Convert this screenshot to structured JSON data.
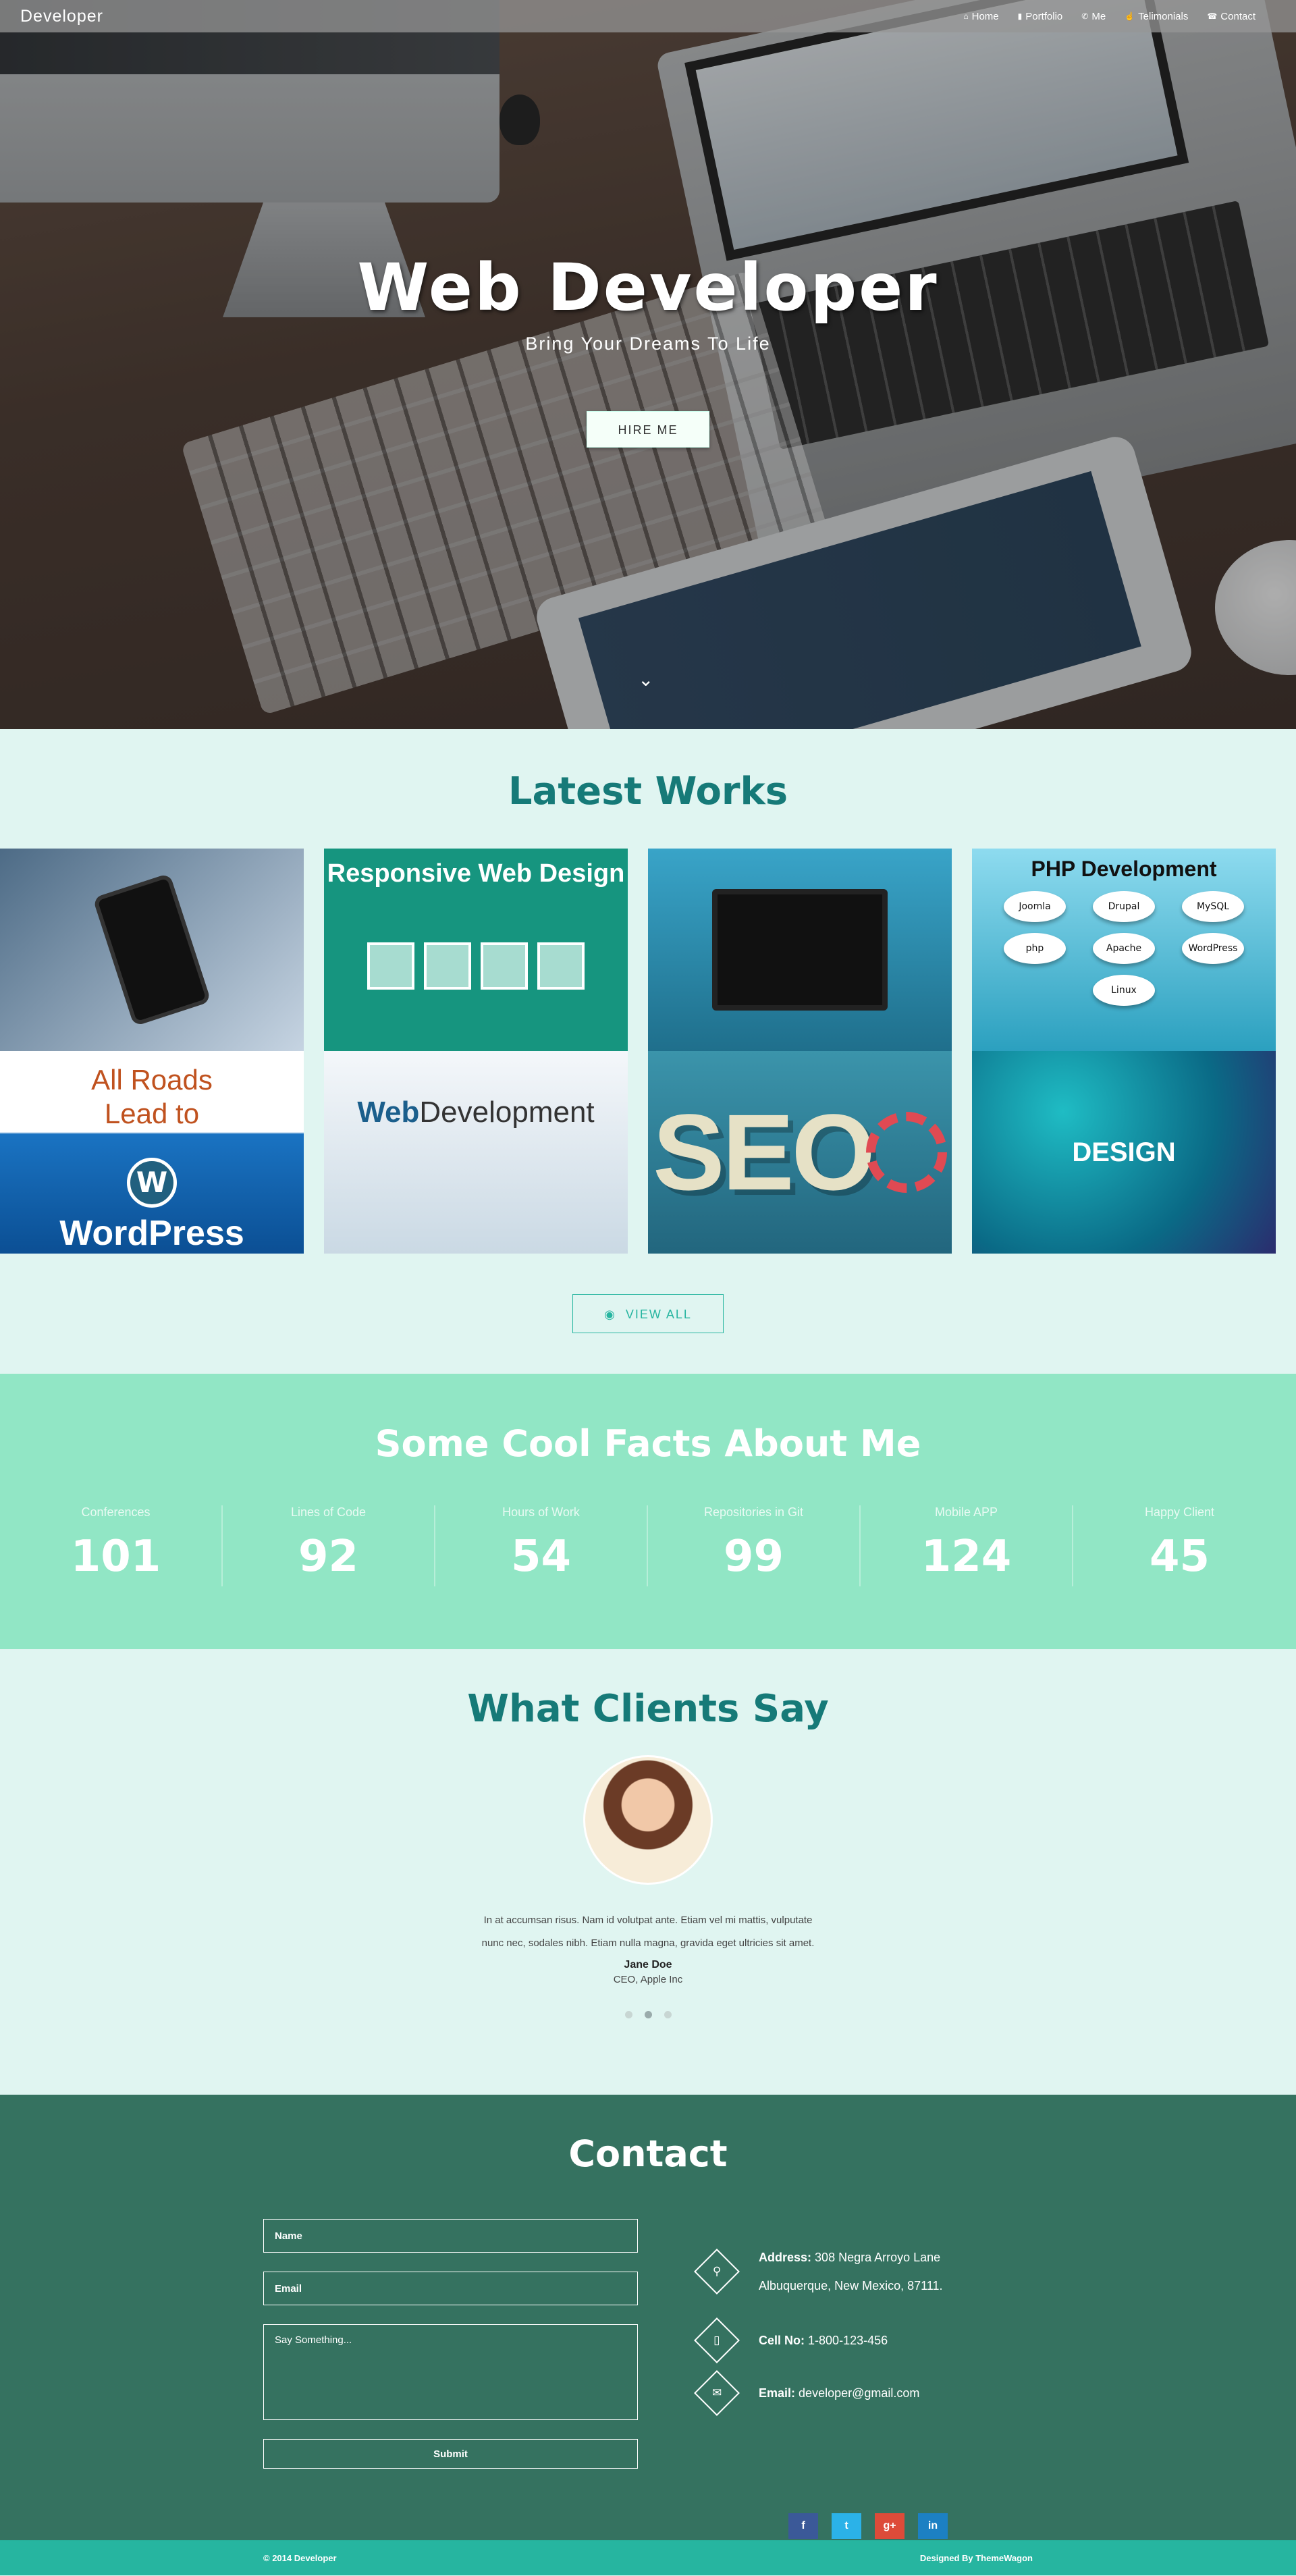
{
  "nav": {
    "brand": "Developer",
    "links": [
      {
        "icon": "home-icon",
        "glyph": "⌂",
        "label": "Home"
      },
      {
        "icon": "bookmark-icon",
        "glyph": "▮",
        "label": "Portfolio"
      },
      {
        "icon": "megaphone-icon",
        "glyph": "✆",
        "label": "Me"
      },
      {
        "icon": "thumbs-up-icon",
        "glyph": "☝",
        "label": "Telimonials"
      },
      {
        "icon": "phone-icon",
        "glyph": "☎",
        "label": "Contact"
      }
    ]
  },
  "hero": {
    "title": "Web Developer",
    "subtitle": "Bring Your Dreams To Life",
    "cta": "HIRE ME",
    "scroll_icon": "chevron-down-icon",
    "scroll_glyph": "⌄"
  },
  "works": {
    "title": "Latest Works",
    "tiles": {
      "responsive": "Responsive Web Design",
      "php": "PHP Development",
      "php_logos": [
        "Joomla",
        "Drupal",
        "MySQL",
        "php",
        "Apache",
        "WordPress",
        "Linux"
      ],
      "wp_line1": "All Roads",
      "wp_line2": "Lead to",
      "wp_line3": "WordPress",
      "wp_logo": "W",
      "webdev_a": "Web",
      "webdev_b": "Development",
      "seo": "SEO",
      "design": "DESIGN"
    },
    "view_all": "VIEW ALL",
    "view_all_icon": "eye-icon",
    "view_all_glyph": "◉"
  },
  "facts": {
    "title": "Some Cool Facts About Me",
    "items": [
      {
        "label": "Conferences",
        "value": "101"
      },
      {
        "label": "Lines of Code",
        "value": "92"
      },
      {
        "label": "Hours of Work",
        "value": "54"
      },
      {
        "label": "Repositories in Git",
        "value": "99"
      },
      {
        "label": "Mobile APP",
        "value": "124"
      },
      {
        "label": "Happy Client",
        "value": "45"
      }
    ]
  },
  "clients": {
    "title": "What Clients Say",
    "quote": "In at accumsan risus. Nam id volutpat ante. Etiam vel mi mattis, vulputate nunc nec, sodales nibh. Etiam nulla magna, gravida eget ultricies sit amet.",
    "name": "Jane Doe",
    "role": "CEO, Apple Inc",
    "slides": 3,
    "active_slide": 2
  },
  "contact": {
    "title": "Contact",
    "form": {
      "name_placeholder": "Name",
      "email_placeholder": "Email",
      "message_placeholder": "Say Something...",
      "submit": "Submit"
    },
    "address_label": "Address:",
    "address_line1": "308 Negra Arroyo Lane",
    "address_line2": "Albuquerque, New Mexico, 87111.",
    "phone_label": "Cell No:",
    "phone": "1-800-123-456",
    "email_label": "Email:",
    "email": "developer@gmail.com",
    "icons": {
      "address": "map-pin-icon",
      "phone": "mobile-icon",
      "email": "envelope-icon"
    },
    "glyphs": {
      "address": "⚲",
      "phone": "▯",
      "email": "✉"
    },
    "socials": [
      {
        "name": "facebook-icon",
        "glyph": "f",
        "color": "#3b5998"
      },
      {
        "name": "twitter-icon",
        "glyph": "t",
        "color": "#2bb2e8"
      },
      {
        "name": "google-plus-icon",
        "glyph": "g+",
        "color": "#dd4b39"
      },
      {
        "name": "linkedin-icon",
        "glyph": "in",
        "color": "#1c80c3"
      }
    ]
  },
  "footer": {
    "copyright": "© 2014 Developer",
    "credit": "Designed By ThemeWagon"
  },
  "colors": {
    "accent": "#167a78",
    "facts_bg": "#91e6c5",
    "contact_bg": "#357260",
    "footer_bg": "#26b5a0"
  }
}
